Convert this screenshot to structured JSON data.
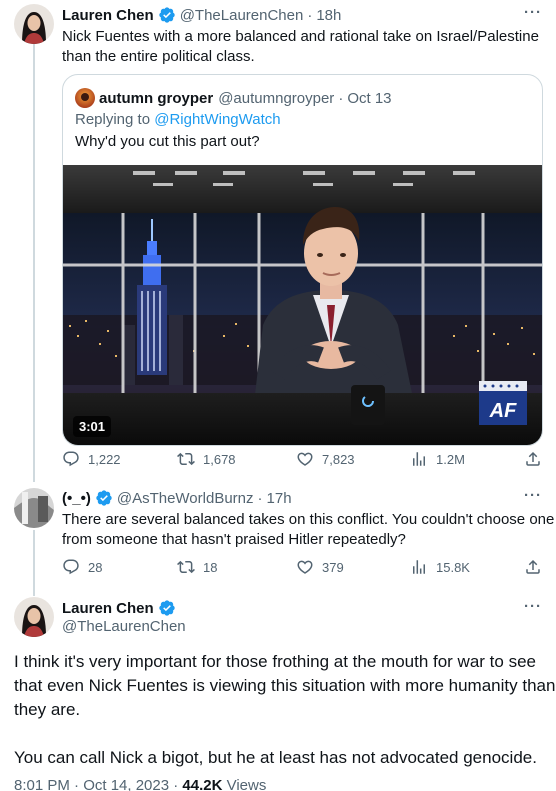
{
  "tweet1": {
    "name": "Lauren Chen",
    "handle": "@TheLaurenChen",
    "time": "18h",
    "more": "···",
    "text_line1": "Nick Fuentes with a more balanced and rational take on Israel/Palestine",
    "text_line2": "than the entire political class.",
    "quote": {
      "name": "autumn groyper",
      "handle": "@autumngroyper",
      "time": "Oct 13",
      "replying_prefix": "Replying to ",
      "replying_handle": "@RightWingWatch",
      "text": "Why'd you cut this part out?",
      "duration": "3:01",
      "watermark": "AF"
    },
    "actions": {
      "replies": "1,222",
      "retweets": "1,678",
      "likes": "7,823",
      "views": "1.2M"
    }
  },
  "tweet2": {
    "name": "(•_•)",
    "handle": "@AsTheWorldBurnz",
    "time": "17h",
    "more": "···",
    "text_line1": "There are several balanced takes on this conflict. You couldn't choose one",
    "text_line2": "from someone that hasn't praised Hitler repeatedly?",
    "actions": {
      "replies": "28",
      "retweets": "18",
      "likes": "379",
      "views": "15.8K"
    }
  },
  "main": {
    "name": "Lauren Chen",
    "handle": "@TheLaurenChen",
    "more": "···",
    "para1_line1": "I think it's very important for those frothing at the mouth for war to see",
    "para1_line2": "that even Nick Fuentes is viewing this situation with more humanity than",
    "para1_line3": "they are.",
    "para2": "You can call Nick a bigot, but he at least has not advocated genocide.",
    "timestamp": "8:01 PM · Oct 14, 2023 · ",
    "views_count": "44.2K",
    "views_label": " Views"
  },
  "colors": {
    "accent": "#1d9bf0",
    "muted": "#536471",
    "text": "#0f1419",
    "border": "#cfd9de"
  },
  "icons": [
    "verified-badge-icon",
    "more-icon",
    "reply-icon",
    "retweet-icon",
    "like-icon",
    "views-icon",
    "share-icon"
  ]
}
